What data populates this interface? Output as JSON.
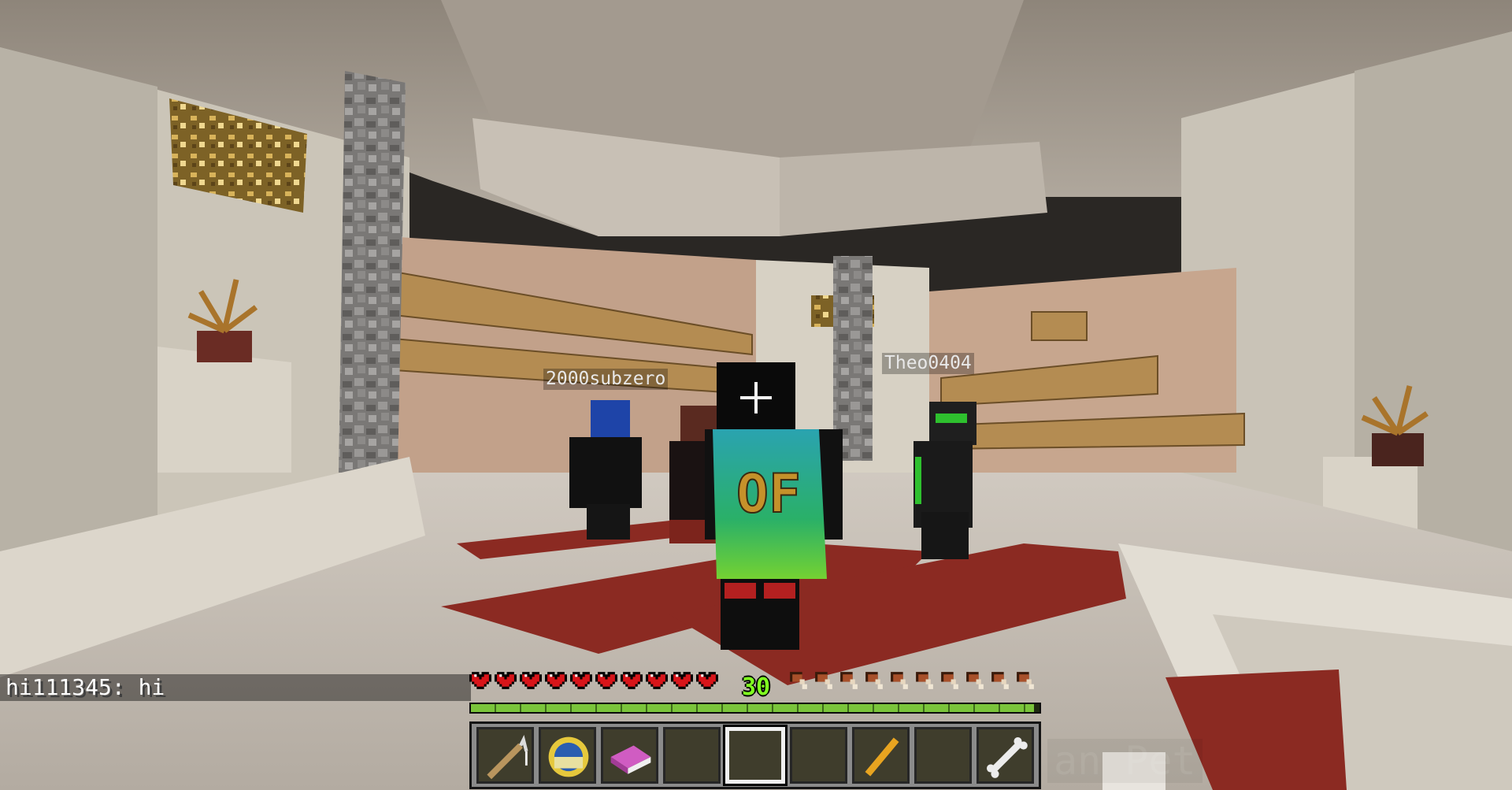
{
  "nametags": [
    "2000subzero",
    "Theo0404"
  ],
  "chat": {
    "messages": [
      {
        "sender": "hi111345",
        "text": "hi",
        "line": "hi111345: hi"
      }
    ]
  },
  "hud": {
    "health": {
      "hearts": 10,
      "filled": 10
    },
    "hunger": {
      "icons": 10,
      "filled": 10
    },
    "xp_level": "30",
    "hotbar": {
      "selected_slot": 5,
      "slots": [
        {
          "item": "fishing-rod-icon"
        },
        {
          "item": "clock-icon"
        },
        {
          "item": "pink-book-icon"
        },
        {
          "item": "empty"
        },
        {
          "item": "empty"
        },
        {
          "item": "empty"
        },
        {
          "item": "golden-rod-icon"
        },
        {
          "item": "empty"
        },
        {
          "item": "bone-icon"
        }
      ]
    }
  },
  "player_cape_text": "OF",
  "faded_pet_label": "an Pet",
  "colors": {
    "xp_level": "#80ff20",
    "heart": "#d8151a",
    "carpet": "#8b2a22",
    "wall": "#d6d1c4"
  }
}
